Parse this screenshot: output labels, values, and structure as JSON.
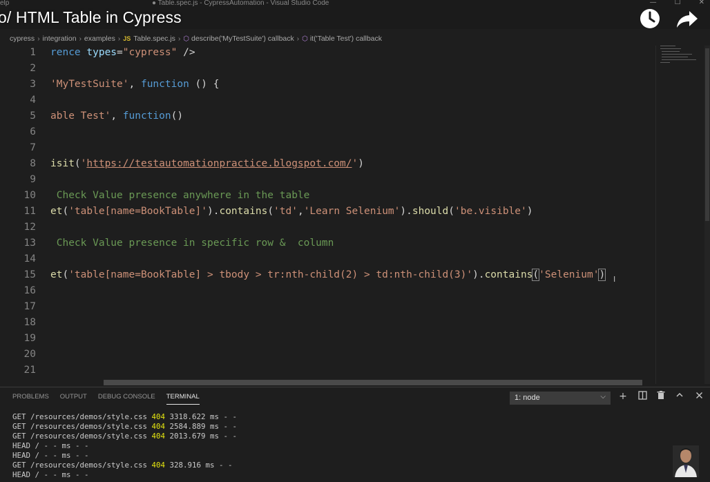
{
  "window": {
    "menu_fragment": "elp",
    "title": "● Table.spec.js - CypressAutomation - Visual Studio Code",
    "controls": [
      "—",
      "☐",
      "✕"
    ]
  },
  "video": {
    "title": "o/ HTML Table in Cypress",
    "icons": [
      "clock-icon",
      "share-icon"
    ]
  },
  "breadcrumb": {
    "items": [
      "cypress",
      "integration",
      "examples",
      "Table.spec.js",
      "describe('MyTestSuite') callback",
      "it('Table Test') callback"
    ],
    "file_badge": "JS"
  },
  "editor": {
    "line_numbers": [
      "1",
      "2",
      "3",
      "4",
      "5",
      "6",
      "7",
      "8",
      "9",
      "10",
      "11",
      "12",
      "13",
      "14",
      "15",
      "16",
      "17",
      "18",
      "19",
      "20",
      "21"
    ],
    "code": {
      "l1_a": "rence ",
      "l1_b": "types",
      "l1_c": "=",
      "l1_d": "\"cypress\"",
      "l1_e": " />",
      "l3_a": "'MyTestSuite'",
      "l3_b": ", ",
      "l3_c": "function",
      "l3_d": " () {",
      "l5_a": "able Test'",
      "l5_b": ", ",
      "l5_c": "function",
      "l5_d": "()",
      "l8_a": "isit",
      "l8_b": "(",
      "l8_c": "'",
      "l8_d": "https://testautomationpractice.blogspot.com/",
      "l8_e": "'",
      "l8_f": ")",
      "l10": " Check Value presence anywhere in the table",
      "l11_a": "et",
      "l11_b": "(",
      "l11_c": "'table[name=BookTable]'",
      "l11_d": ").",
      "l11_e": "contains",
      "l11_f": "(",
      "l11_g": "'td'",
      "l11_h": ",",
      "l11_i": "'Learn Selenium'",
      "l11_j": ").",
      "l11_k": "should",
      "l11_l": "(",
      "l11_m": "'be.visible'",
      "l11_n": ")",
      "l13": " Check Value presence in specific row &  column",
      "l15_a": "et",
      "l15_b": "(",
      "l15_c": "'table[name=BookTable] > tbody > tr:nth-child(2) > td:nth-child(3)'",
      "l15_d": ").",
      "l15_e": "contains",
      "l15_f": "(",
      "l15_g": "'Selenium'",
      "l15_h": ")"
    }
  },
  "panel": {
    "tabs": [
      "PROBLEMS",
      "OUTPUT",
      "DEBUG CONSOLE",
      "TERMINAL"
    ],
    "active_tab": "TERMINAL",
    "terminal_select": "1: node",
    "actions": [
      "plus-icon",
      "split-icon",
      "trash-icon",
      "maximize-icon",
      "close-icon"
    ],
    "terminal_lines": [
      {
        "pre": "GET /resources/demos/style.css ",
        "status": "404",
        "post": " 3318.622 ms - -"
      },
      {
        "pre": "GET /resources/demos/style.css ",
        "status": "404",
        "post": " 2584.889 ms - -"
      },
      {
        "pre": "GET /resources/demos/style.css ",
        "status": "404",
        "post": " 2013.679 ms - -"
      },
      {
        "pre": "HEAD / - - ms - -",
        "status": "",
        "post": ""
      },
      {
        "pre": "HEAD / - - ms - -",
        "status": "",
        "post": ""
      },
      {
        "pre": "GET /resources/demos/style.css ",
        "status": "404",
        "post": " 328.916 ms - -"
      },
      {
        "pre": "HEAD / - - ms - -",
        "status": "",
        "post": ""
      }
    ]
  },
  "colors": {
    "keyword": "#569cd6",
    "string": "#ce9178",
    "comment": "#6a9955",
    "function": "#dcdcaa",
    "attribute": "#9cdcfe",
    "status_404": "#e5e510"
  }
}
